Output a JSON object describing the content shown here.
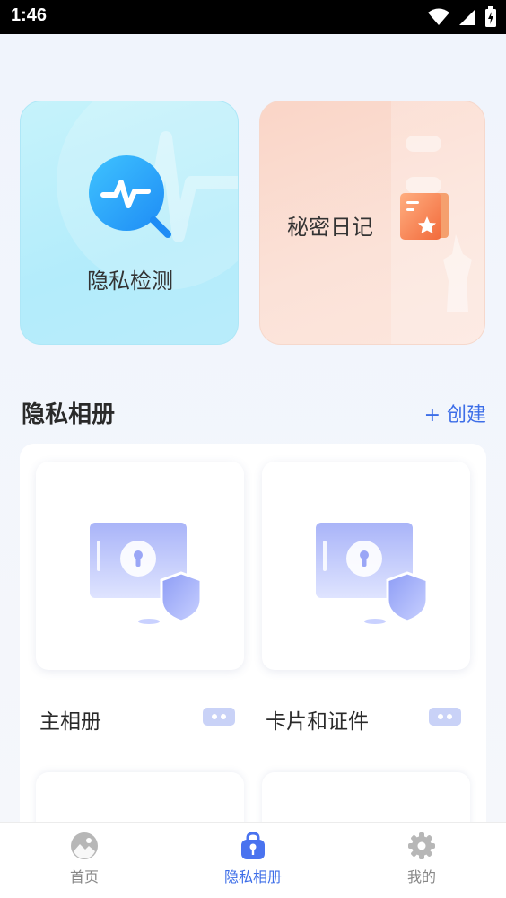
{
  "status_bar": {
    "time": "1:46"
  },
  "cards": {
    "privacy_check": {
      "label": "隐私检测"
    },
    "secret_diary": {
      "label": "秘密日记"
    }
  },
  "section": {
    "title": "隐私相册",
    "create_label": "+ 创建"
  },
  "albums": [
    {
      "name": "主相册"
    },
    {
      "name": "卡片和证件"
    }
  ],
  "tabs": [
    {
      "label": "首页",
      "icon": "gallery-icon",
      "active": false
    },
    {
      "label": "隐私相册",
      "icon": "lock-icon",
      "active": true
    },
    {
      "label": "我的",
      "icon": "gear-icon",
      "active": false
    }
  ],
  "colors": {
    "accent": "#3d6ee8",
    "inactive_tab": "#888888"
  }
}
